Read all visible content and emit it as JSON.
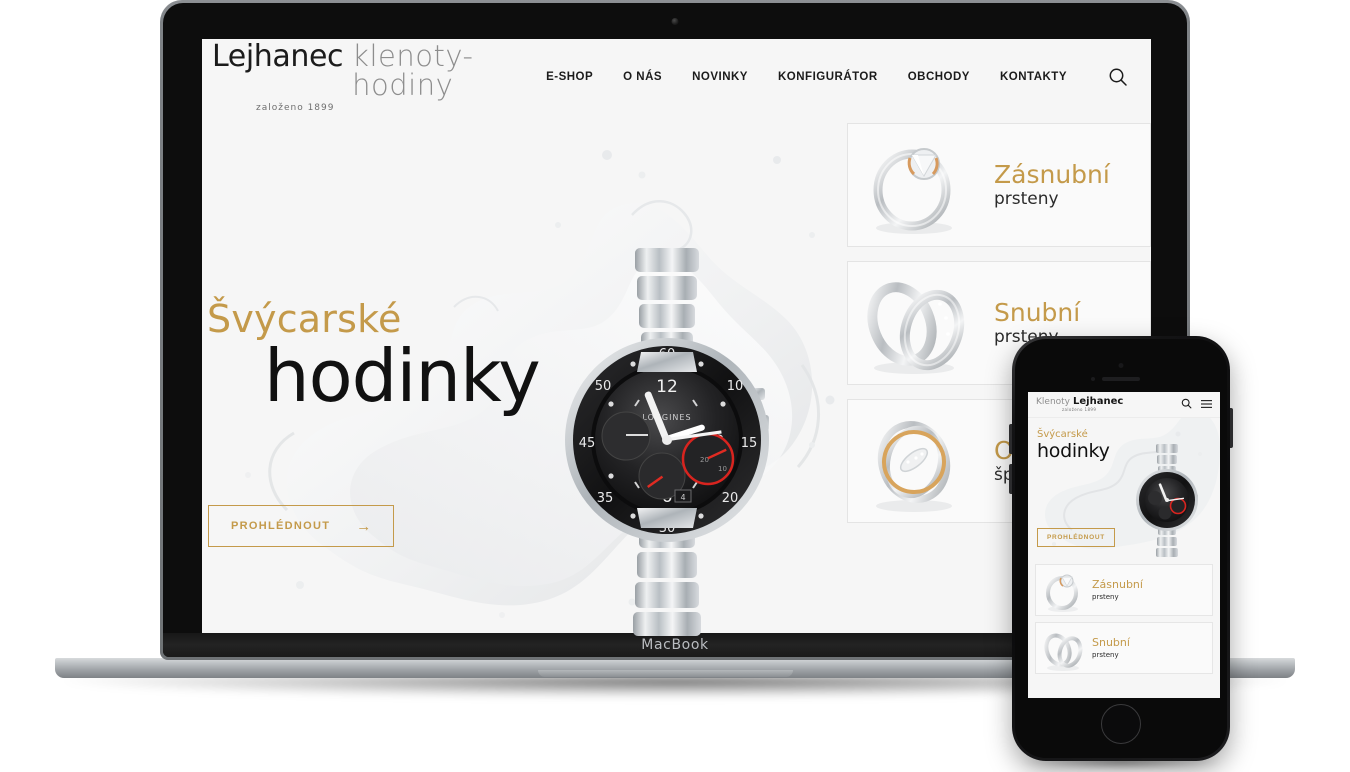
{
  "devices": {
    "laptop_label": "MacBook",
    "laptop_name": "macbook-mockup",
    "phone_name": "iphone-mockup"
  },
  "site": {
    "logo": {
      "main": "Lejhanec",
      "sub": "klenoty-hodiny",
      "established": "založeno 1899"
    },
    "nav": [
      {
        "label": "E-SHOP"
      },
      {
        "label": "O NÁS"
      },
      {
        "label": "NOVINKY"
      },
      {
        "label": "KONFIGURÁTOR"
      },
      {
        "label": "OBCHODY"
      },
      {
        "label": "KONTAKTY"
      }
    ],
    "search_icon": "search-icon",
    "hero": {
      "kicker": "Švýcarské",
      "title": "hodinky",
      "cta_label": "PROHLÉDNOUT",
      "cta_arrow": "→",
      "product_image": "longines-chronograph-watch-with-water-splash"
    },
    "cards": [
      {
        "title": "Zásnubní",
        "sub": "prsteny",
        "image": "solitaire-diamond-ring"
      },
      {
        "title": "Snubní",
        "sub": "prsteny",
        "image": "pair-of-wedding-bands"
      },
      {
        "title": "Ostatní",
        "sub": "šperky",
        "image": "crossover-gold-diamond-ring"
      }
    ]
  },
  "mobile": {
    "logo": {
      "pre": "Klenoty",
      "main": "Lejhanec",
      "established": "založeno 1899"
    },
    "search_icon": "search-icon",
    "menu_icon": "hamburger-menu-icon",
    "hero": {
      "kicker": "Švýcarské",
      "title": "hodinky",
      "cta_label": "PROHLÉDNOUT"
    },
    "cards": [
      {
        "title": "Zásnubní",
        "sub": "prsteny"
      },
      {
        "title": "Snubní",
        "sub": "prsteny"
      }
    ]
  },
  "colors": {
    "gold": "#c49a4a",
    "text_dark": "#1b1b1b",
    "page_bg": "#f6f6f6",
    "card_border": "#e4e4e4"
  }
}
